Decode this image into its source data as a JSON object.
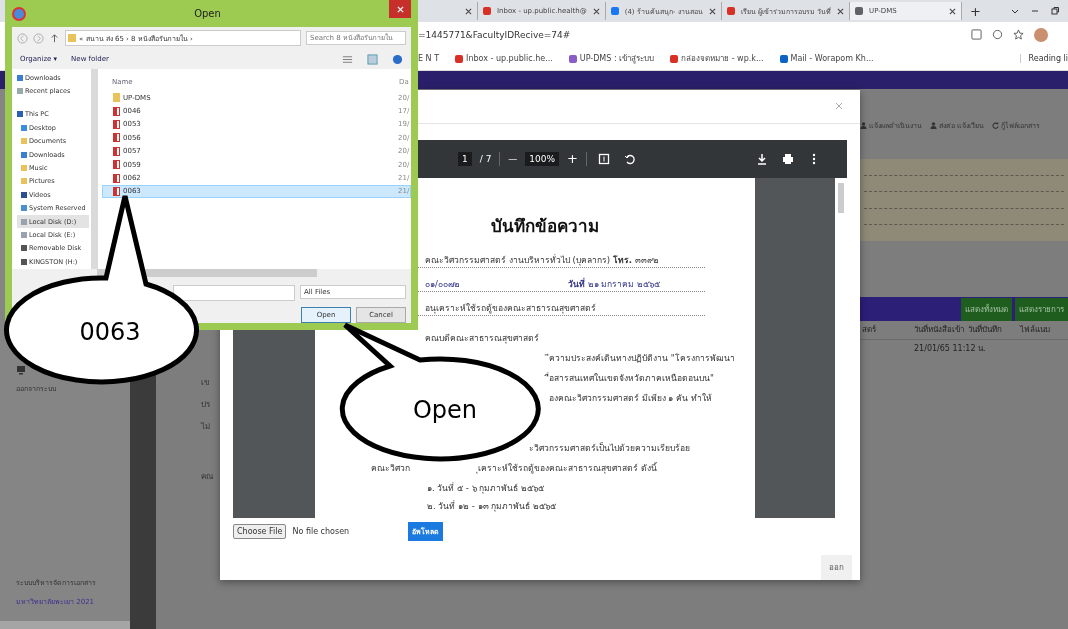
{
  "browser": {
    "tabs": [
      {
        "kind": "none",
        "selected": false
      },
      {
        "kind": "gmail",
        "title": "Inbox - up.public.health@",
        "selected": false
      },
      {
        "kind": "facebook",
        "title": "(4) ร้านค้นสนุก- งานสอน",
        "selected": false
      },
      {
        "kind": "gmail",
        "title": "เรียน ผู้เข้าร่วมการอบรม วันที่",
        "selected": false
      },
      {
        "kind": "globe",
        "title": "UP-DMS",
        "selected": true
      }
    ],
    "new_tab": "+",
    "address": "=1445771&FacultyIDRecive=74#",
    "bookmarks": [
      {
        "kind": "none",
        "title": "E N T"
      },
      {
        "kind": "gmail",
        "title": "Inbox - up.public.he..."
      },
      {
        "kind": "person",
        "title": "UP-DMS : เข้าสู่ระบบ"
      },
      {
        "kind": "gmail",
        "title": "กล่องจดหมาย - wp.k..."
      },
      {
        "kind": "outlook",
        "title": "Mail - Worapom Kh..."
      }
    ],
    "reading_list": "Reading li"
  },
  "page": {
    "sidebar": {
      "logout": "ออกจากระบบ",
      "footer_title": "ระบบบริหารจัดการเอกสาร",
      "footer_org": "มหาวิทยาลัยพะเยา 2021"
    },
    "fragments": [
      "เข",
      "ปร",
      "ไม่",
      "คณ"
    ],
    "menu": [
      {
        "kind": "person",
        "label": "แจ้งผลดำเนินงาน"
      },
      {
        "kind": "person",
        "label": "ส่งต่อ แจ้งเวียน"
      },
      {
        "kind": "refresh",
        "label": "กู้ไฟล์เอกสาร"
      }
    ],
    "action_buttons": [
      "แสดงทั้งหมด",
      "แสดงรายการ"
    ],
    "table": {
      "columns": [
        "สดร์",
        "วันที่หนังสือเข้า",
        "วันที่บันทึก",
        "ไฟล์แนบ"
      ],
      "rows": [
        [
          "",
          "21/01/65 11:12 น.",
          "",
          ""
        ]
      ]
    }
  },
  "modal": {
    "pdf_toolbar": {
      "page": "1",
      "total": "/ 7",
      "minus": "—",
      "zoom": "100%",
      "plus": "+"
    },
    "document": {
      "title": "บันทึกข้อความ",
      "lines": [
        {
          "parts": [
            "คณะวิศวกรรมศาสตร์ งานบริหารทั่วไป (บุคลากร) **โทร.** ๓๓๙๒"
          ]
        },
        {
          "parts": [
            "๐๑/๐๐๗๒",
            "**วันที่** ๒๑ มกราคม ๒๕๖๕"
          ]
        },
        {
          "parts": [
            "อนุเคราะห์ใช้รถตู้ของคณะสาธารณสุขศาสตร์"
          ]
        },
        {
          "parts": [
            "คณบดีคณะสาธารณสุขศาสตร์"
          ]
        },
        {
          "parts": [
            "ีความประสงค์เดินทางปฏิบัติงาน \"โครงการพัฒนา"
          ]
        },
        {
          "parts": [
            "ื่อสารสนเทศในเขตจังหวัดภาคเหนือตอนบน\""
          ]
        },
        {
          "parts": [
            "องคณะวิศวกรรมศาสตร์ มีเพียง ๑ คัน ทำให้"
          ]
        },
        {
          "parts": [
            "ะวิศวกรรมศาสตร์เป็นไปด้วยความเรียบร้อย"
          ]
        },
        {
          "parts": [
            "คณะวิศวก",
            "ุเคราะห์ใช้รถตู้ของคณะสาธารณสุขศาสตร์ ดังนี้"
          ]
        },
        {
          "parts": [
            "๑.  วันที่ ๕ - ๖ กุมภาพันธ์ ๒๕๖๕"
          ]
        },
        {
          "parts": [
            "๒. วันที่ ๑๒ - ๑๓ กุมภาพันธ์ ๒๕๖๕"
          ]
        }
      ]
    },
    "choose_file": "Choose File",
    "no_file": "No file chosen",
    "upload": "อัพโหลด",
    "exit": "ออก"
  },
  "open_dialog": {
    "title": "Open",
    "breadcrumb": "« สนาน ส่ง 65  ›  8 หนังสือรับภายใน  ›",
    "search": {
      "placeholder": "Search 8 หนังสือรับภายใน"
    },
    "organize": "Organize ▾",
    "new_folder": "New folder",
    "nav": [
      {
        "kind": "downloads",
        "label": "Downloads",
        "selected": false
      },
      {
        "kind": "recent",
        "label": "Recent places",
        "selected": false
      },
      {
        "kind": "pc",
        "label": "This PC",
        "selected": false,
        "children": [
          {
            "kind": "desktop",
            "label": "Desktop",
            "selected": false
          },
          {
            "kind": "folder",
            "label": "Documents",
            "selected": false
          },
          {
            "kind": "downloads",
            "label": "Downloads",
            "selected": false
          },
          {
            "kind": "music",
            "label": "Music",
            "selected": false
          },
          {
            "kind": "folder",
            "label": "Pictures",
            "selected": false
          },
          {
            "kind": "videos",
            "label": "Videos",
            "selected": false
          },
          {
            "kind": "system",
            "label": "System Reserved",
            "selected": false
          },
          {
            "kind": "drive",
            "label": "Local Disk (D:)",
            "selected": true
          },
          {
            "kind": "drive",
            "label": "Local Disk (E:)",
            "selected": false
          },
          {
            "kind": "usb",
            "label": "Removable Disk",
            "selected": false
          },
          {
            "kind": "usb",
            "label": "KINGSTON (H:)",
            "selected": false
          }
        ]
      }
    ],
    "columns": [
      "Name",
      "Da"
    ],
    "files": [
      {
        "kind": "folder",
        "name": "UP-DMS",
        "date": "20/",
        "selected": false
      },
      {
        "kind": "pdf",
        "name": "0046",
        "date": "17/",
        "selected": false
      },
      {
        "kind": "pdf",
        "name": "0053",
        "date": "19/",
        "selected": false
      },
      {
        "kind": "pdf",
        "name": "0056",
        "date": "20/",
        "selected": false
      },
      {
        "kind": "pdf",
        "name": "0057",
        "date": "20/",
        "selected": false
      },
      {
        "kind": "pdf",
        "name": "0059",
        "date": "20/",
        "selected": false
      },
      {
        "kind": "pdf",
        "name": "0062",
        "date": "21/",
        "selected": false
      },
      {
        "kind": "pdf",
        "name": "0063",
        "date": "21/",
        "selected": true
      }
    ],
    "file_type": "All Files",
    "open": "Open",
    "cancel": "Cancel"
  },
  "callouts": [
    {
      "text": "0063"
    },
    {
      "text": "Open"
    }
  ]
}
